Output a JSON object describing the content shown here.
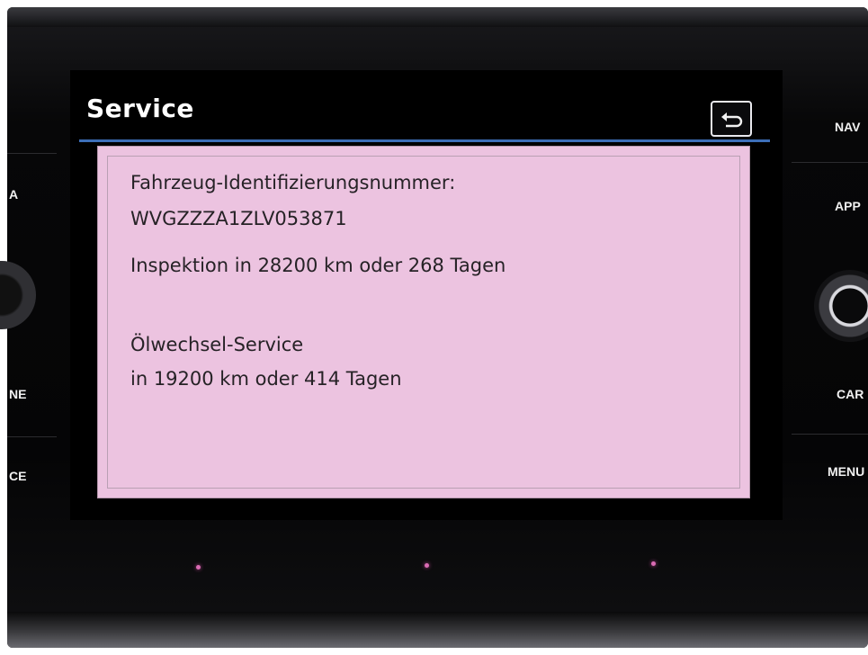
{
  "screen": {
    "title": "Service",
    "back_icon": "back-arrow-icon"
  },
  "service_info": {
    "vin_label": "Fahrzeug-Identifizierungsnummer:",
    "vin_value": "WVGZZZA1ZLV053871",
    "inspection": "Inspektion in 28200 km oder 268 Tagen",
    "oil_service_title": "Ölwechsel-Service",
    "oil_service_detail": "in 19200 km oder 414 Tagen"
  },
  "hardware_buttons": {
    "nav": "NAV",
    "app": "APP",
    "car": "CAR",
    "menu": "MENU",
    "left_partial_1": "A",
    "left_partial_2": "NE",
    "left_partial_3": "CE"
  },
  "colors": {
    "content_background": "#ecc3e0",
    "title_rule": "#3d6fb8",
    "indicator_dots": "#d96bb3"
  }
}
